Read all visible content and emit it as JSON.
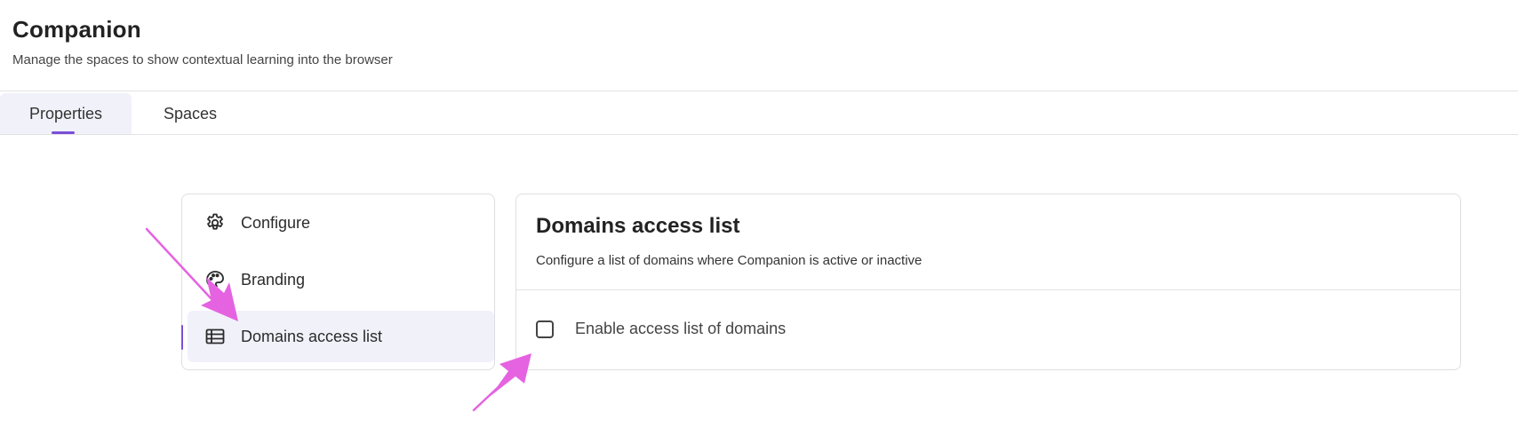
{
  "page": {
    "title": "Companion",
    "subtitle": "Manage the spaces to show contextual learning into the browser"
  },
  "tabs": [
    {
      "label": "Properties",
      "active": true
    },
    {
      "label": "Spaces",
      "active": false
    }
  ],
  "sidebar": {
    "items": [
      {
        "label": "Configure",
        "icon": "gear-icon",
        "active": false
      },
      {
        "label": "Branding",
        "icon": "palette-icon",
        "active": false
      },
      {
        "label": "Domains access list",
        "icon": "table-list-icon",
        "active": true
      }
    ]
  },
  "main": {
    "title": "Domains access list",
    "description": "Configure a list of domains where Companion is active or inactive",
    "checkbox": {
      "label": "Enable access list of domains",
      "checked": false
    }
  },
  "colors": {
    "accent": "#7a4fd6",
    "active_bg": "#f1f1fa",
    "annotation_arrow": "#e563e0",
    "border": "#dedee2"
  }
}
